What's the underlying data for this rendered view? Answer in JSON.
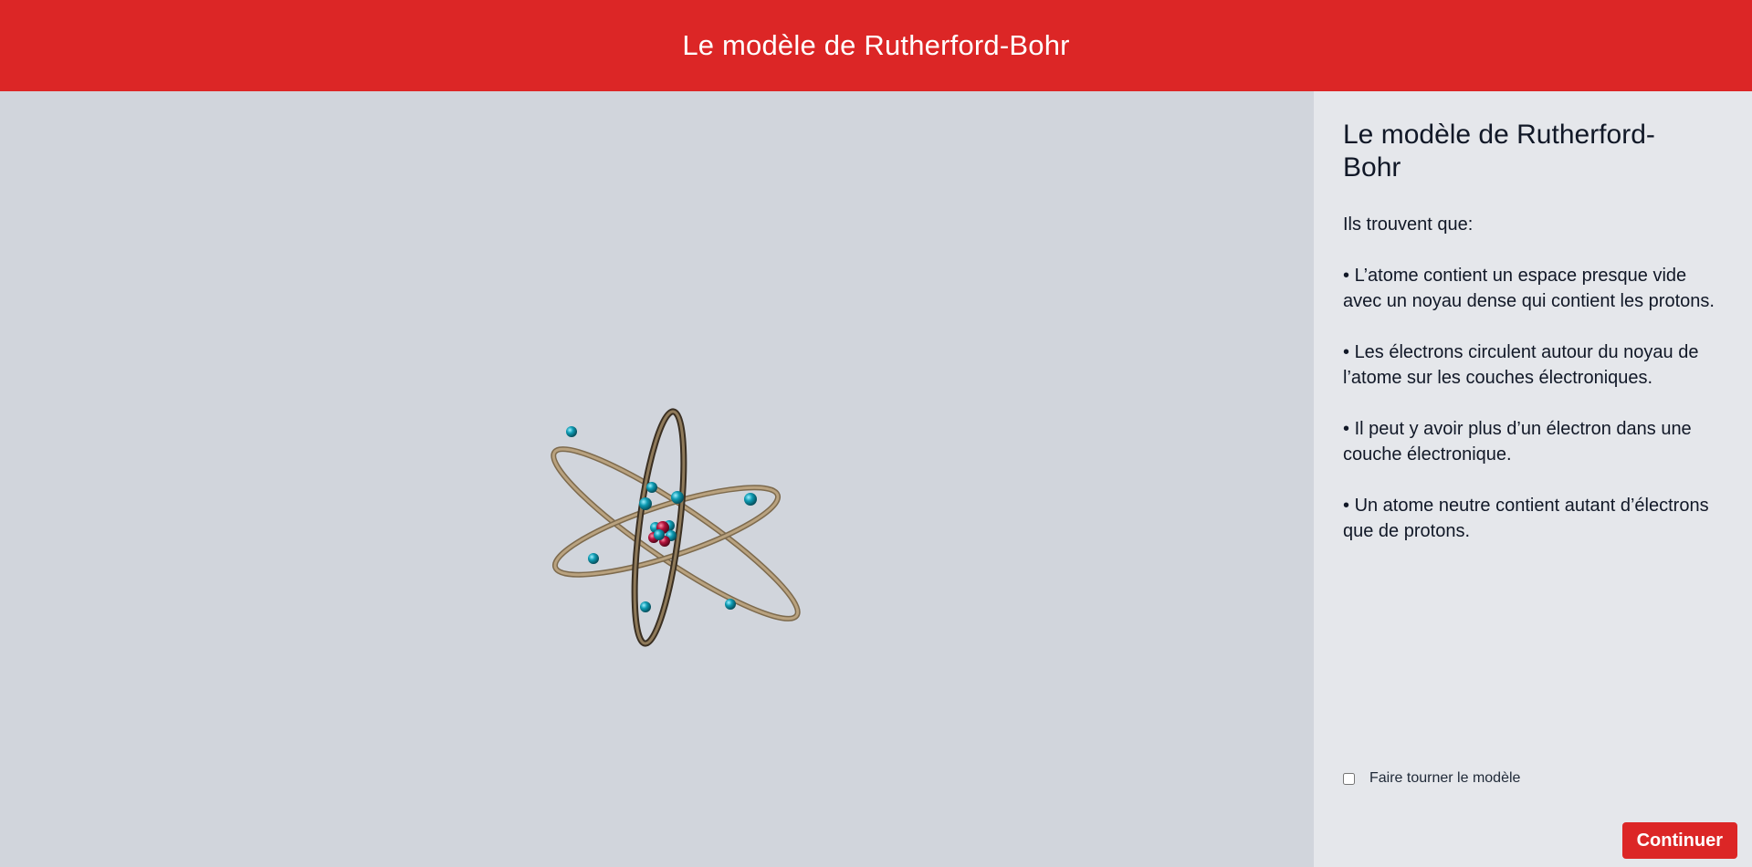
{
  "header": {
    "title": "Le modèle de Rutherford-Bohr"
  },
  "viewer": {
    "model": "atom-3d-model"
  },
  "panel": {
    "title": "Le modèle de Rutherford-Bohr",
    "intro": "Ils trouvent que:",
    "bullets": [
      "L’atome contient un espace presque vide avec un noyau dense qui contient les protons.",
      "Les électrons circulent autour du noyau de l’atome sur les couches électroniques.",
      "Il peut y avoir plus d’un électron dans une couche électronique.",
      "Un atome neutre contient autant d’électrons que de protons."
    ],
    "rotate_label": "Faire tourner le modèle",
    "rotate_checked": false,
    "continue_label": "Continuer"
  },
  "colors": {
    "header_bg": "#dc2626",
    "viewer_bg": "#d1d5dc",
    "panel_bg": "#e5e7eb",
    "electron": "#0e9bb3",
    "proton": "#b3123b",
    "orbit": "#a58e6b"
  }
}
